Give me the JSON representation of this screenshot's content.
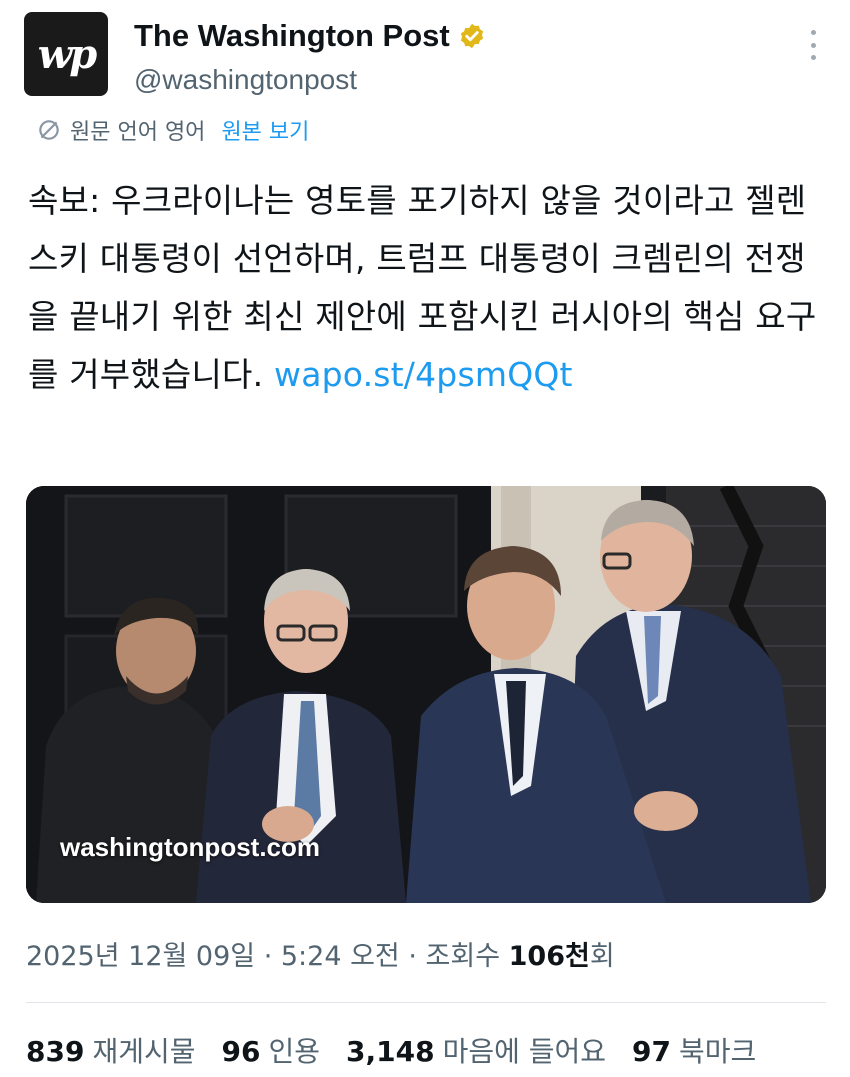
{
  "account": {
    "avatar_text": "wp",
    "display_name": "The Washington Post",
    "handle": "@washingtonpost",
    "verified_icon": "verified-badge-icon",
    "verified_color": "#e2b719"
  },
  "translation": {
    "notice": "원문 언어 영어",
    "view_original": "원본 보기",
    "icon": "translate-icon"
  },
  "tweet": {
    "text": "속보: 우크라이나는 영토를 포기하지 않을 것이라고 젤렌스키 대통령이 선언하며, 트럼프 대통령이 크렘린의 전쟁을 끝내기 위한 최신 제안에 포함시킨 러시아의 핵심 요구를 거부했습니다. ",
    "link": "wapo.st/4psmQQt",
    "link_color": "#1d9bf0"
  },
  "media": {
    "watermark": "washingtonpost.com"
  },
  "meta": {
    "date": "2025년 12월 09일",
    "separator": " · ",
    "time": "5:24 오전",
    "views_label": "조회수 ",
    "views_count": "106천",
    "views_suffix": "회"
  },
  "stats": {
    "reposts_count": "839",
    "reposts_label": "재게시물",
    "quotes_count": "96",
    "quotes_label": "인용",
    "likes_count": "3,148",
    "likes_label": "마음에 들어요",
    "bookmarks_count": "97",
    "bookmarks_label": "북마크"
  }
}
